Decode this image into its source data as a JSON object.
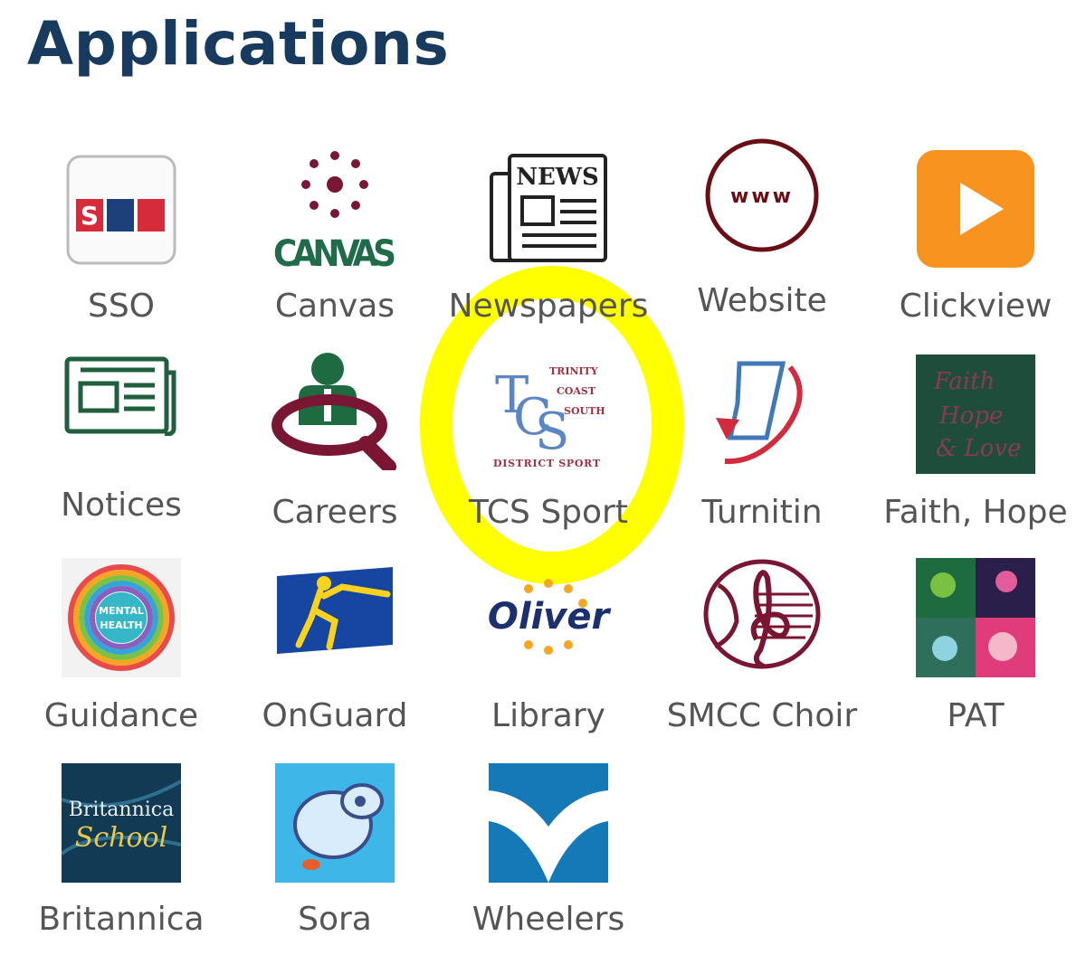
{
  "title": "Applications",
  "apps": [
    {
      "label": "SSO",
      "icon": "sso-icon",
      "badge": "SSO"
    },
    {
      "label": "Canvas",
      "icon": "canvas-icon",
      "wordmark": "CANVAS"
    },
    {
      "label": "Newspapers",
      "icon": "newspaper-icon",
      "masthead": "NEWS"
    },
    {
      "label": "Website",
      "icon": "www-globe-icon",
      "text": "www"
    },
    {
      "label": "Clickview",
      "icon": "play-icon"
    },
    {
      "label": "Notices",
      "icon": "notice-board-icon"
    },
    {
      "label": "Careers",
      "icon": "careers-magnifier-icon"
    },
    {
      "label": "TCS Sport",
      "icon": "tcs-sport-logo",
      "logo_lines": [
        "TRINITY",
        "COAST",
        "SOUTH",
        "DISTRICT SPORT"
      ]
    },
    {
      "label": "Turnitin",
      "icon": "turnitin-icon"
    },
    {
      "label": "Faith, Hope",
      "icon": "faith-hope-love-icon",
      "script": "Faith Hope & Love"
    },
    {
      "label": "Guidance",
      "icon": "mental-health-icon",
      "text": "MENTAL HEALTH"
    },
    {
      "label": "OnGuard",
      "icon": "fencer-icon"
    },
    {
      "label": "Library",
      "icon": "oliver-library-icon",
      "wordmark": "Oliver"
    },
    {
      "label": "SMCC Choir",
      "icon": "choir-treble-clef-icon"
    },
    {
      "label": "PAT",
      "icon": "pat-collage-icon"
    },
    {
      "label": "Britannica",
      "icon": "britannica-school-icon",
      "wordmark": [
        "Britannica",
        "School"
      ]
    },
    {
      "label": "Sora",
      "icon": "sora-icon"
    },
    {
      "label": "Wheelers",
      "icon": "wheelers-book-icon"
    }
  ],
  "highlight": {
    "target": "TCS Sport",
    "color": "#ffff00"
  }
}
